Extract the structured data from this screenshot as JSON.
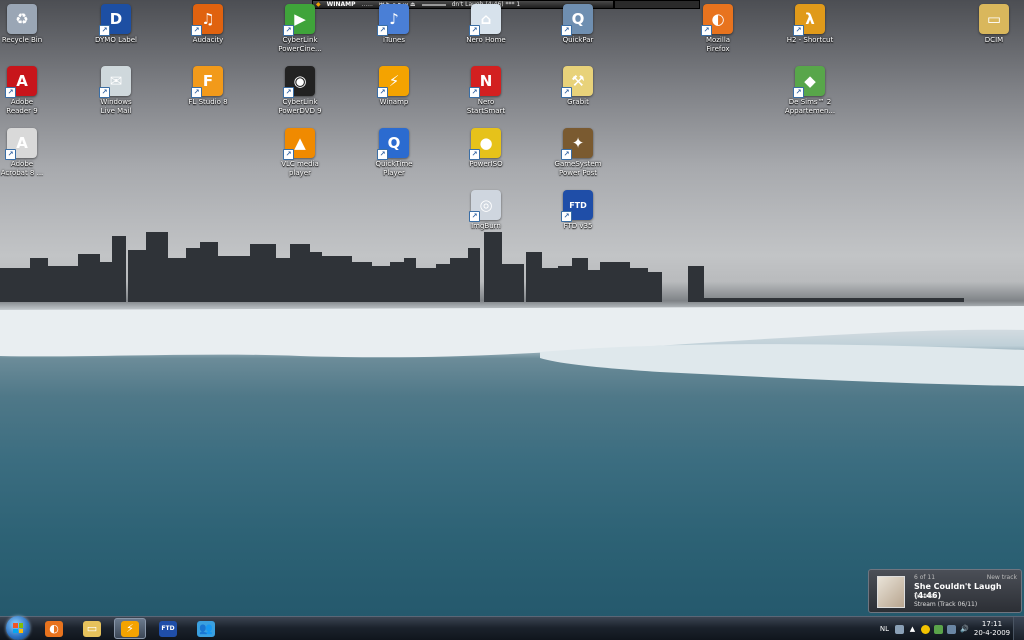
{
  "desktop_icons": [
    {
      "label": "Recycle Bin",
      "icon": "recycle-bin-icon",
      "color": "#9aa6b5",
      "glyph": "♻",
      "shortcut": false
    },
    {
      "label": "Adobe\nReader 9",
      "icon": "adobe-reader-icon",
      "color": "#c8151b",
      "glyph": "A",
      "shortcut": true
    },
    {
      "label": "Adobe\nAcrobat 8 ...",
      "icon": "adobe-acrobat-icon",
      "color": "#d9d9d9",
      "glyph": "A",
      "shortcut": true
    },
    {
      "label": "DYMO Label",
      "icon": "dymo-label-icon",
      "color": "#1d4fa3",
      "glyph": "D",
      "shortcut": true
    },
    {
      "label": "Windows\nLive Mail",
      "icon": "windows-live-mail-icon",
      "color": "#cfd8dc",
      "glyph": "✉",
      "shortcut": true
    },
    {
      "label": "Audacity",
      "icon": "audacity-icon",
      "color": "#e0620f",
      "glyph": "♫",
      "shortcut": true
    },
    {
      "label": "FL Studio 8",
      "icon": "fl-studio-icon",
      "color": "#f29a1a",
      "glyph": "F",
      "shortcut": true
    },
    {
      "label": "CyberLink\nPowerCine...",
      "icon": "powercinema-icon",
      "color": "#3fa43a",
      "glyph": "▶",
      "shortcut": true
    },
    {
      "label": "CyberLink\nPowerDVD 9",
      "icon": "powerdvd-icon",
      "color": "#222222",
      "glyph": "◉",
      "shortcut": true
    },
    {
      "label": "VLC media\nplayer",
      "icon": "vlc-icon",
      "color": "#f08a00",
      "glyph": "▲",
      "shortcut": true
    },
    {
      "label": "iTunes",
      "icon": "itunes-icon",
      "color": "#4a7fd6",
      "glyph": "♪",
      "shortcut": true
    },
    {
      "label": "Winamp",
      "icon": "winamp-icon",
      "color": "#f4a300",
      "glyph": "⚡",
      "shortcut": true
    },
    {
      "label": "QuickTime\nPlayer",
      "icon": "quicktime-icon",
      "color": "#2b6bd0",
      "glyph": "Q",
      "shortcut": true
    },
    {
      "label": "Nero Home",
      "icon": "nero-home-icon",
      "color": "#d7e2ec",
      "glyph": "⌂",
      "shortcut": true
    },
    {
      "label": "Nero\nStartSmart",
      "icon": "nero-startsmart-icon",
      "color": "#d32020",
      "glyph": "N",
      "shortcut": true
    },
    {
      "label": "PowerISO",
      "icon": "poweriso-icon",
      "color": "#e6c21a",
      "glyph": "●",
      "shortcut": true
    },
    {
      "label": "ImgBurn",
      "icon": "imgburn-icon",
      "color": "#cfd6df",
      "glyph": "◎",
      "shortcut": true
    },
    {
      "label": "QuickPar",
      "icon": "quickpar-icon",
      "color": "#6f8fb1",
      "glyph": "Q",
      "shortcut": true
    },
    {
      "label": "Grabit",
      "icon": "grabit-icon",
      "color": "#e8d27a",
      "glyph": "⚒",
      "shortcut": true
    },
    {
      "label": "GameSystem\nPower Post",
      "icon": "power-post-icon",
      "color": "#7a5a30",
      "glyph": "✦",
      "shortcut": true
    },
    {
      "label": "FTD v35",
      "icon": "ftd-icon",
      "color": "#1f4ea8",
      "glyph": "FTD",
      "shortcut": true
    },
    {
      "label": "Mozilla\nFirefox",
      "icon": "firefox-icon",
      "color": "#e8731e",
      "glyph": "◐",
      "shortcut": true
    },
    {
      "label": "H2 - Shortcut",
      "icon": "half-life-2-icon",
      "color": "#e09a1a",
      "glyph": "λ",
      "shortcut": true
    },
    {
      "label": "De Sims™ 2\nAppartemen...",
      "icon": "sims-2-icon",
      "color": "#58a64a",
      "glyph": "◆",
      "shortcut": true
    },
    {
      "label": "DCIM",
      "icon": "folder-icon",
      "color": "#d9b75c",
      "glyph": "▭",
      "shortcut": false
    }
  ],
  "winamp": {
    "app_name": "WINAMP",
    "title_dots": "......",
    "song": "dn't Laugh (4:46) *** 1"
  },
  "popup": {
    "track_count": "6 of 11",
    "header": "New track",
    "title": "She Couldn't Laugh (4:46)",
    "artist": "Twarres",
    "stream": "Stream (Track 06/11)"
  },
  "taskbar": {
    "pinned": [
      {
        "name": "taskbar-firefox",
        "icon": "firefox-icon",
        "color": "#e8731e",
        "glyph": "◐",
        "active": false
      },
      {
        "name": "taskbar-explorer",
        "icon": "folder-icon",
        "color": "#e6c25c",
        "glyph": "▭",
        "active": false
      },
      {
        "name": "taskbar-winamp",
        "icon": "winamp-icon",
        "color": "#f4a300",
        "glyph": "⚡",
        "active": true
      },
      {
        "name": "taskbar-ftd",
        "icon": "ftd-icon",
        "color": "#1f4ea8",
        "glyph": "FTD",
        "active": false
      },
      {
        "name": "taskbar-messenger",
        "icon": "messenger-icon",
        "color": "#3aa0e0",
        "glyph": "👥",
        "active": false
      }
    ],
    "language": "NL",
    "time": "17:11",
    "date": "20-4-2009"
  }
}
